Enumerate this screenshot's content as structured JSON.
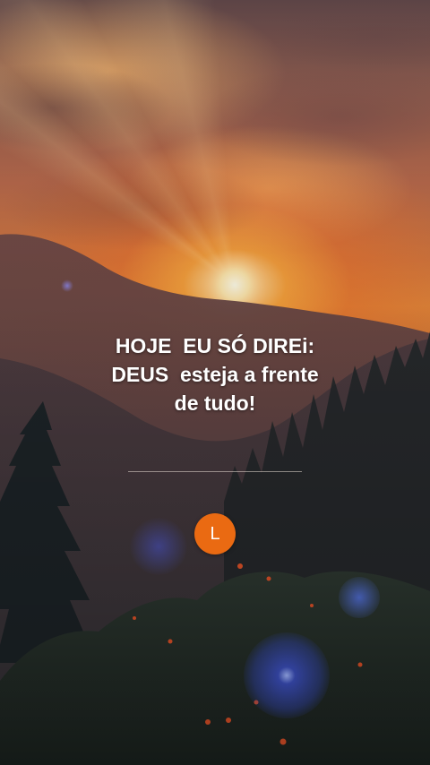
{
  "post": {
    "quote_lines": [
      "HOJE  EU SÓ DIREi:",
      "DEUS  esteja a frente",
      "de tudo!"
    ],
    "author_initial": "L",
    "avatar_color": "#ea6a12"
  },
  "colors": {
    "sun": "#fff2c8",
    "sky_orange": "#e58a3c",
    "text": "#ffffff"
  }
}
